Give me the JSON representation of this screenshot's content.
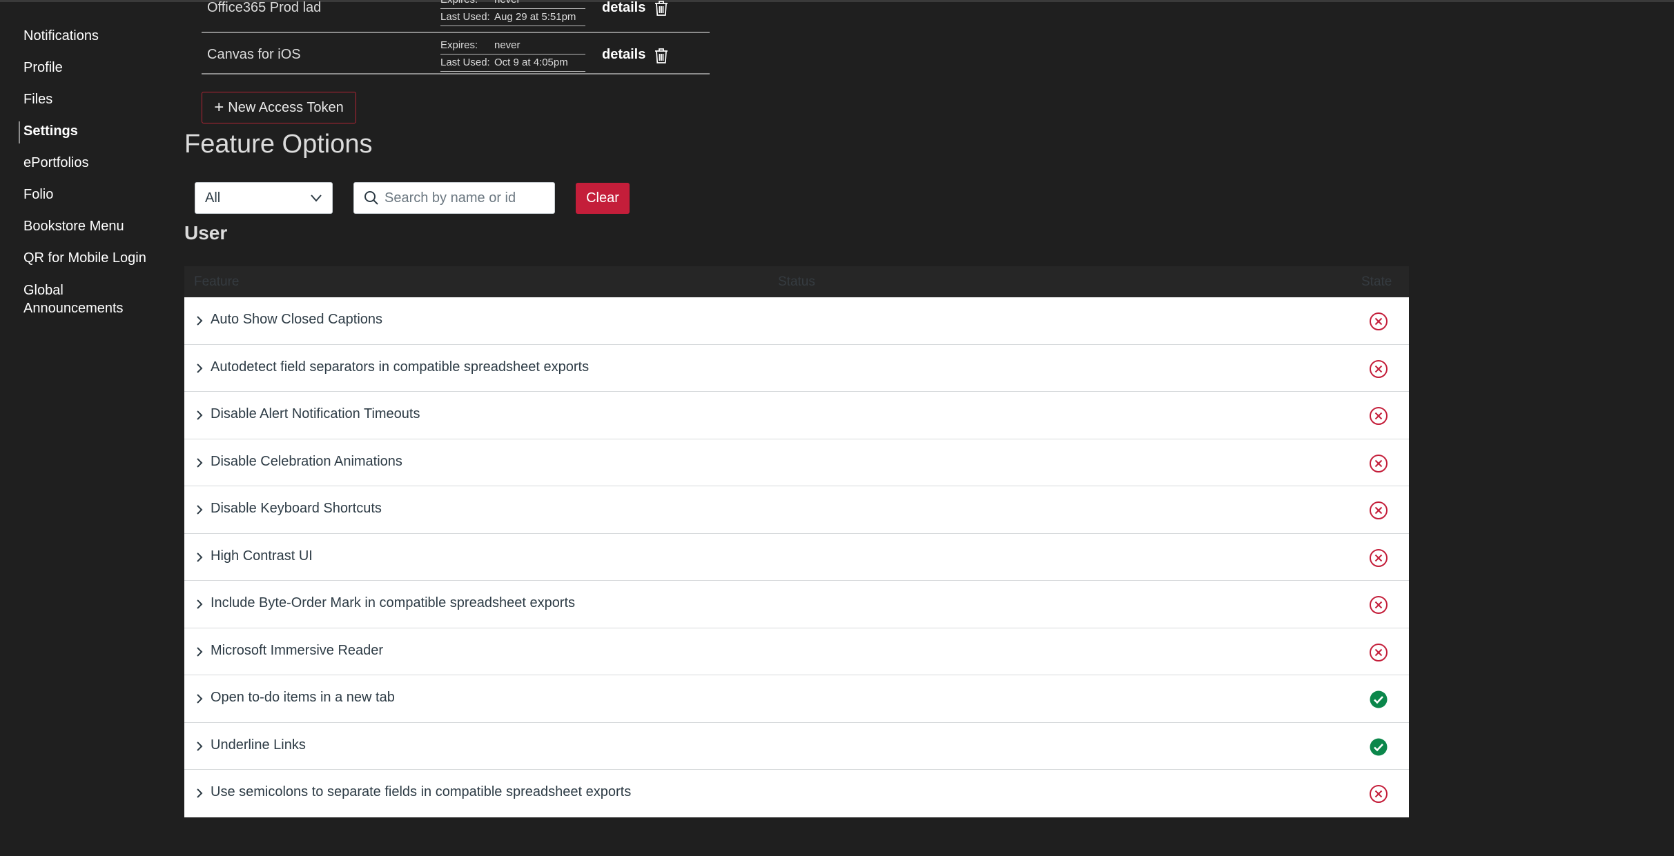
{
  "sidebar": {
    "items": [
      {
        "label": "Notifications"
      },
      {
        "label": "Profile"
      },
      {
        "label": "Files"
      },
      {
        "label": "Settings"
      },
      {
        "label": "ePortfolios"
      },
      {
        "label": "Folio"
      },
      {
        "label": "Bookstore Menu"
      },
      {
        "label": "QR for Mobile Login"
      },
      {
        "label": "Global Announcements"
      }
    ],
    "active": "Settings"
  },
  "tokens": {
    "rows": [
      {
        "name": "Office365 Prod lad",
        "expires_key": "Expires:",
        "expires_value": "never",
        "last_used_key": "Last Used:",
        "last_used_value": "Aug 29 at 5:51pm",
        "details_label": "details"
      },
      {
        "name": "Canvas for iOS",
        "expires_key": "Expires:",
        "expires_value": "never",
        "last_used_key": "Last Used:",
        "last_used_value": "Oct 9 at 4:05pm",
        "details_label": "details"
      }
    ],
    "new_button_label": "New Access Token"
  },
  "feature_options": {
    "title": "Feature Options",
    "filter": {
      "selected": "All"
    },
    "search": {
      "placeholder": "Search by name or id"
    },
    "clear_label": "Clear",
    "section_title": "User",
    "columns": {
      "feature": "Feature",
      "status": "Status",
      "state": "State"
    },
    "rows": [
      {
        "label": "Auto Show Closed Captions",
        "state": "off"
      },
      {
        "label": "Autodetect field separators in compatible spreadsheet exports",
        "state": "off"
      },
      {
        "label": "Disable Alert Notification Timeouts",
        "state": "off"
      },
      {
        "label": "Disable Celebration Animations",
        "state": "off"
      },
      {
        "label": "Disable Keyboard Shortcuts",
        "state": "off"
      },
      {
        "label": "High Contrast UI",
        "state": "off"
      },
      {
        "label": "Include Byte-Order Mark in compatible spreadsheet exports",
        "state": "off"
      },
      {
        "label": "Microsoft Immersive Reader",
        "state": "off"
      },
      {
        "label": "Open to-do items in a new tab",
        "state": "on"
      },
      {
        "label": "Underline Links",
        "state": "on"
      },
      {
        "label": "Use semicolons to separate fields in compatible spreadsheet exports",
        "state": "off"
      }
    ]
  },
  "colors": {
    "background": "#1f1f1f",
    "accent_red": "#c41e3a",
    "state_on": "#0b874b",
    "state_off": "#c41e3a"
  },
  "icons": {
    "state_on": "check-circle-icon",
    "state_off": "x-circle-icon",
    "delete": "trash-icon",
    "expand": "chevron-right-icon",
    "search": "search-icon",
    "dropdown": "chevron-down-icon",
    "add": "plus-icon"
  }
}
